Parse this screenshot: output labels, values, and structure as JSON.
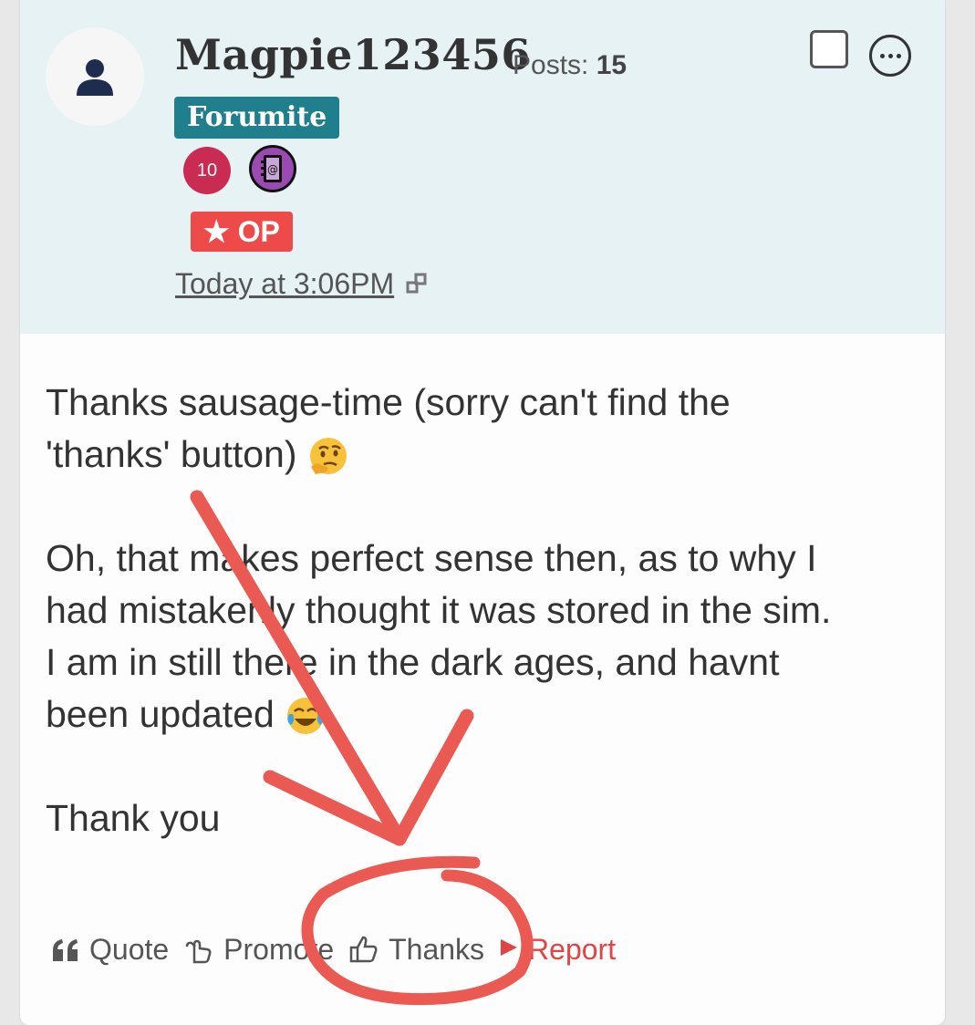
{
  "post": {
    "username": "Magpie123456",
    "posts_label": "Posts:",
    "posts_count": "15",
    "role": "Forumite",
    "badge_count": "10",
    "op_label": "★ OP",
    "timestamp": "Today at 3:06PM",
    "body": {
      "line1": "Thanks sausage-time (sorry can't find the",
      "line2": "'thanks' button)",
      "para2_line1": "Oh, that makes perfect sense then, as to why I",
      "para2_line2": "had mistakenly thought it was stored in the sim.",
      "para2_line3": "I am in still there in the dark ages, and havnt",
      "para2_line4": "been updated",
      "para3": "Thank you"
    },
    "actions": {
      "quote": "Quote",
      "promote": "Promote",
      "thanks": "Thanks",
      "report": "Report"
    }
  },
  "colors": {
    "header_bg": "#e6f2f4",
    "role_bg": "#1f7f8c",
    "op_bg": "#ef4a4a",
    "badge_bg": "#c92b52",
    "report": "#e04444",
    "annotation": "#ea5a52"
  },
  "icons": [
    "user-avatar-icon",
    "checkbox-icon",
    "more-options-icon",
    "notebook-badge-icon",
    "permalink-icon",
    "thinking-face-emoji",
    "crying-laughing-emoji",
    "quote-icon",
    "promote-hand-icon",
    "thumbs-up-icon",
    "report-flag-icon"
  ]
}
